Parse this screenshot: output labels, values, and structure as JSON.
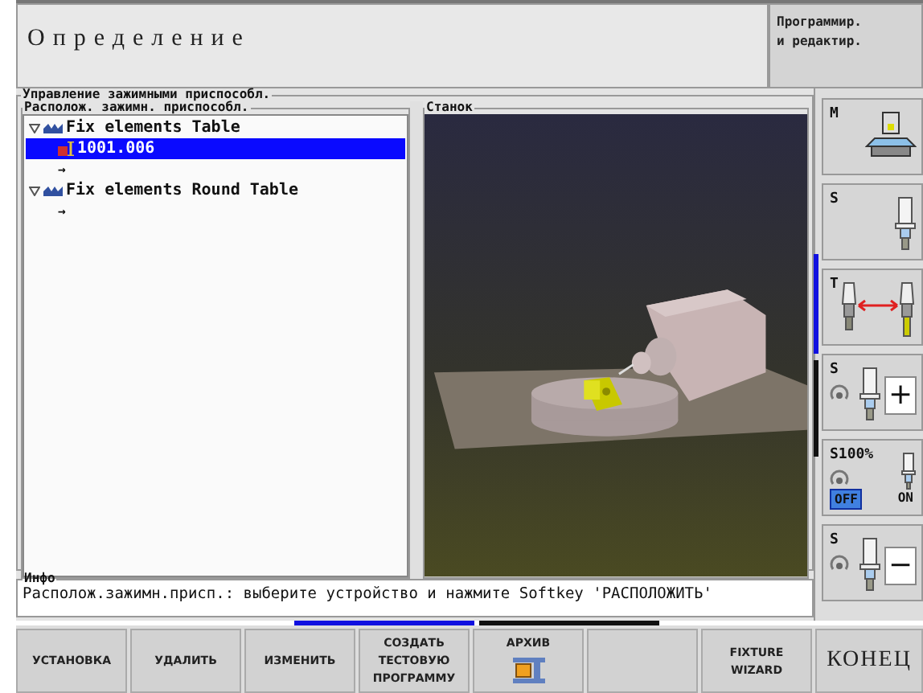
{
  "header": {
    "title": "Определение",
    "mode": [
      "Программир.",
      "и редактир."
    ]
  },
  "panel": {
    "title": "Управление зажимными приспособл.",
    "tree_title": "Располож. зажимн. приспособл.",
    "tree": [
      {
        "label": "Fix elements Table",
        "expanded": true,
        "selected": false,
        "children": [
          {
            "kind": "fixture",
            "label": "1001.006",
            "selected": true
          },
          {
            "kind": "new",
            "label": "→",
            "selected": false
          }
        ]
      },
      {
        "label": "Fix elements Round Table",
        "expanded": true,
        "selected": false,
        "children": [
          {
            "kind": "new",
            "label": "→",
            "selected": false
          }
        ]
      }
    ],
    "viewer_title": "Станок"
  },
  "info": {
    "title": "Инфо",
    "text": "Располож.зажимн.присп.: выберите устройство и нажмите Softkey 'РАСПОЛОЖИТЬ'"
  },
  "side_softkeys": [
    {
      "kind": "machine",
      "label": "M"
    },
    {
      "kind": "spindle",
      "label": "S"
    },
    {
      "kind": "tool-change",
      "label": "T"
    },
    {
      "kind": "spindle-sign",
      "label": "S",
      "sign": "+"
    },
    {
      "kind": "override",
      "label": "S100%",
      "options": [
        {
          "label": "OFF",
          "selected": true
        },
        {
          "label": "ON",
          "selected": false
        }
      ]
    },
    {
      "kind": "spindle-sign",
      "label": "S",
      "sign": "−"
    }
  ],
  "softkeys": [
    {
      "kind": "text",
      "lines": [
        "УСТАНОВКА"
      ]
    },
    {
      "kind": "text",
      "lines": [
        "УДАЛИТЬ"
      ]
    },
    {
      "kind": "text",
      "lines": [
        "ИЗМЕНИТЬ"
      ]
    },
    {
      "kind": "text",
      "lines": [
        "СОЗДАТЬ",
        "ТЕСТОВУЮ",
        "ПРОГРАММУ"
      ]
    },
    {
      "kind": "icon",
      "lines": [
        "АРХИВ"
      ]
    },
    {
      "kind": "empty"
    },
    {
      "kind": "text",
      "lines": [
        "FIXTURE",
        "WIZARD"
      ]
    },
    {
      "kind": "end",
      "lines": [
        "КОНЕЦ"
      ]
    }
  ]
}
